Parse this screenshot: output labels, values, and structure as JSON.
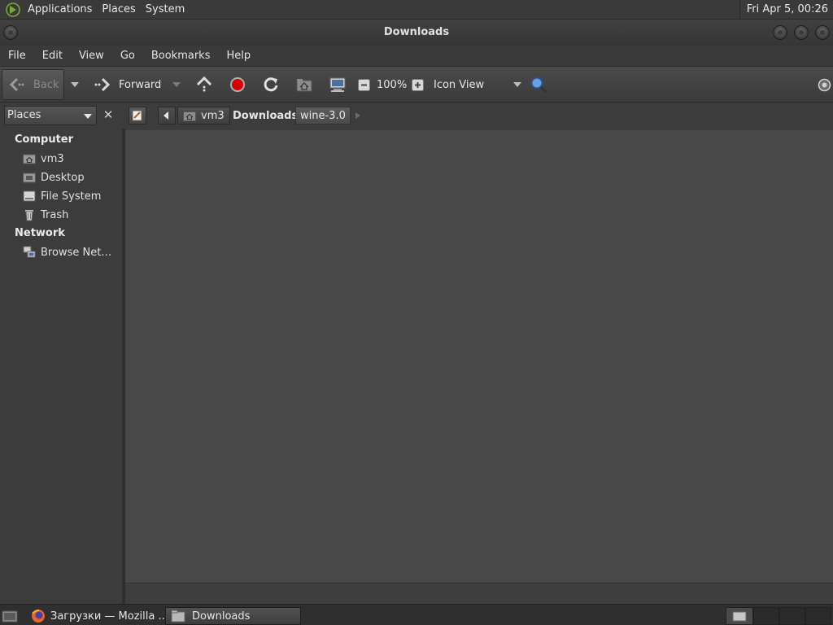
{
  "top_panel": {
    "menus": [
      "Applications",
      "Places",
      "System"
    ],
    "clock": "Fri Apr  5, 00:26"
  },
  "window": {
    "title": "Downloads"
  },
  "menubar": [
    "File",
    "Edit",
    "View",
    "Go",
    "Bookmarks",
    "Help"
  ],
  "toolbar": {
    "back_label": "Back",
    "forward_label": "Forward",
    "zoom_level": "100%",
    "view_mode": "Icon View"
  },
  "sidebar": {
    "selector_label": "Places",
    "sections": [
      {
        "title": "Computer",
        "items": [
          "vm3",
          "Desktop",
          "File System",
          "Trash"
        ]
      },
      {
        "title": "Network",
        "items": [
          "Browse Net…"
        ]
      }
    ]
  },
  "pathbar": {
    "crumbs": [
      "vm3",
      "Downloads",
      "wine-3.0"
    ]
  },
  "taskbar": {
    "tasks": [
      "Загрузки — Mozilla ...",
      "Downloads"
    ]
  },
  "colors": {
    "stop_red": "#d40000",
    "background": "#3c3c3c",
    "content": "#484848"
  }
}
